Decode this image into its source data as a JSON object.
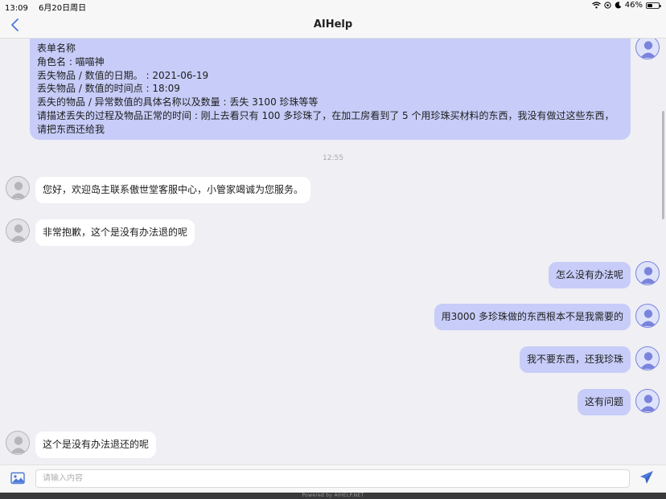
{
  "status_bar": {
    "time": "13:09",
    "date": "6月20日周日",
    "battery": "46%",
    "battery_level": 0.46
  },
  "nav": {
    "title": "AIHelp"
  },
  "form_message": {
    "lines": [
      "表单名称",
      "角色名 : 喵喵神",
      "丢失物品 / 数值的日期。 : 2021-06-19",
      "丢失物品 / 数值的时间点 : 18:09",
      "丢失的物品 / 异常数值的具体名称以及数量 : 丢失 3100 珍珠等等",
      "请描述丢失的过程及物品正常的时间 : 刚上去看只有 100 多珍珠了，在加工房看到了 5 个用珍珠买材料的东西，我没有做过这些东西，请把东西还给我"
    ]
  },
  "timestamp": "12:55",
  "messages": [
    {
      "side": "agent",
      "text": "您好，欢迎岛主联系傲世堂客服中心，小管家竭诚为您服务。"
    },
    {
      "side": "agent",
      "text": "非常抱歉，这个是没有办法退的呢"
    },
    {
      "side": "user",
      "text": "怎么没有办法呢"
    },
    {
      "side": "user",
      "text": "用3000 多珍珠做的东西根本不是我需要的"
    },
    {
      "side": "user",
      "text": "我不要东西，还我珍珠"
    },
    {
      "side": "user",
      "text": "这有问题"
    },
    {
      "side": "agent",
      "text": "这个是没有办法退还的呢"
    }
  ],
  "input": {
    "placeholder": "请输入内容"
  },
  "footer": {
    "text": "Powered by AIHELP.NET"
  },
  "colors": {
    "user_bubble": "#c7cdf8",
    "agent_bubble": "#ffffff",
    "accent": "#4a78d8"
  },
  "icons": [
    "wifi-icon",
    "location-icon",
    "moon-icon",
    "battery-icon",
    "back-chevron-icon",
    "user-avatar-icon",
    "agent-avatar-icon",
    "image-icon",
    "send-icon"
  ]
}
